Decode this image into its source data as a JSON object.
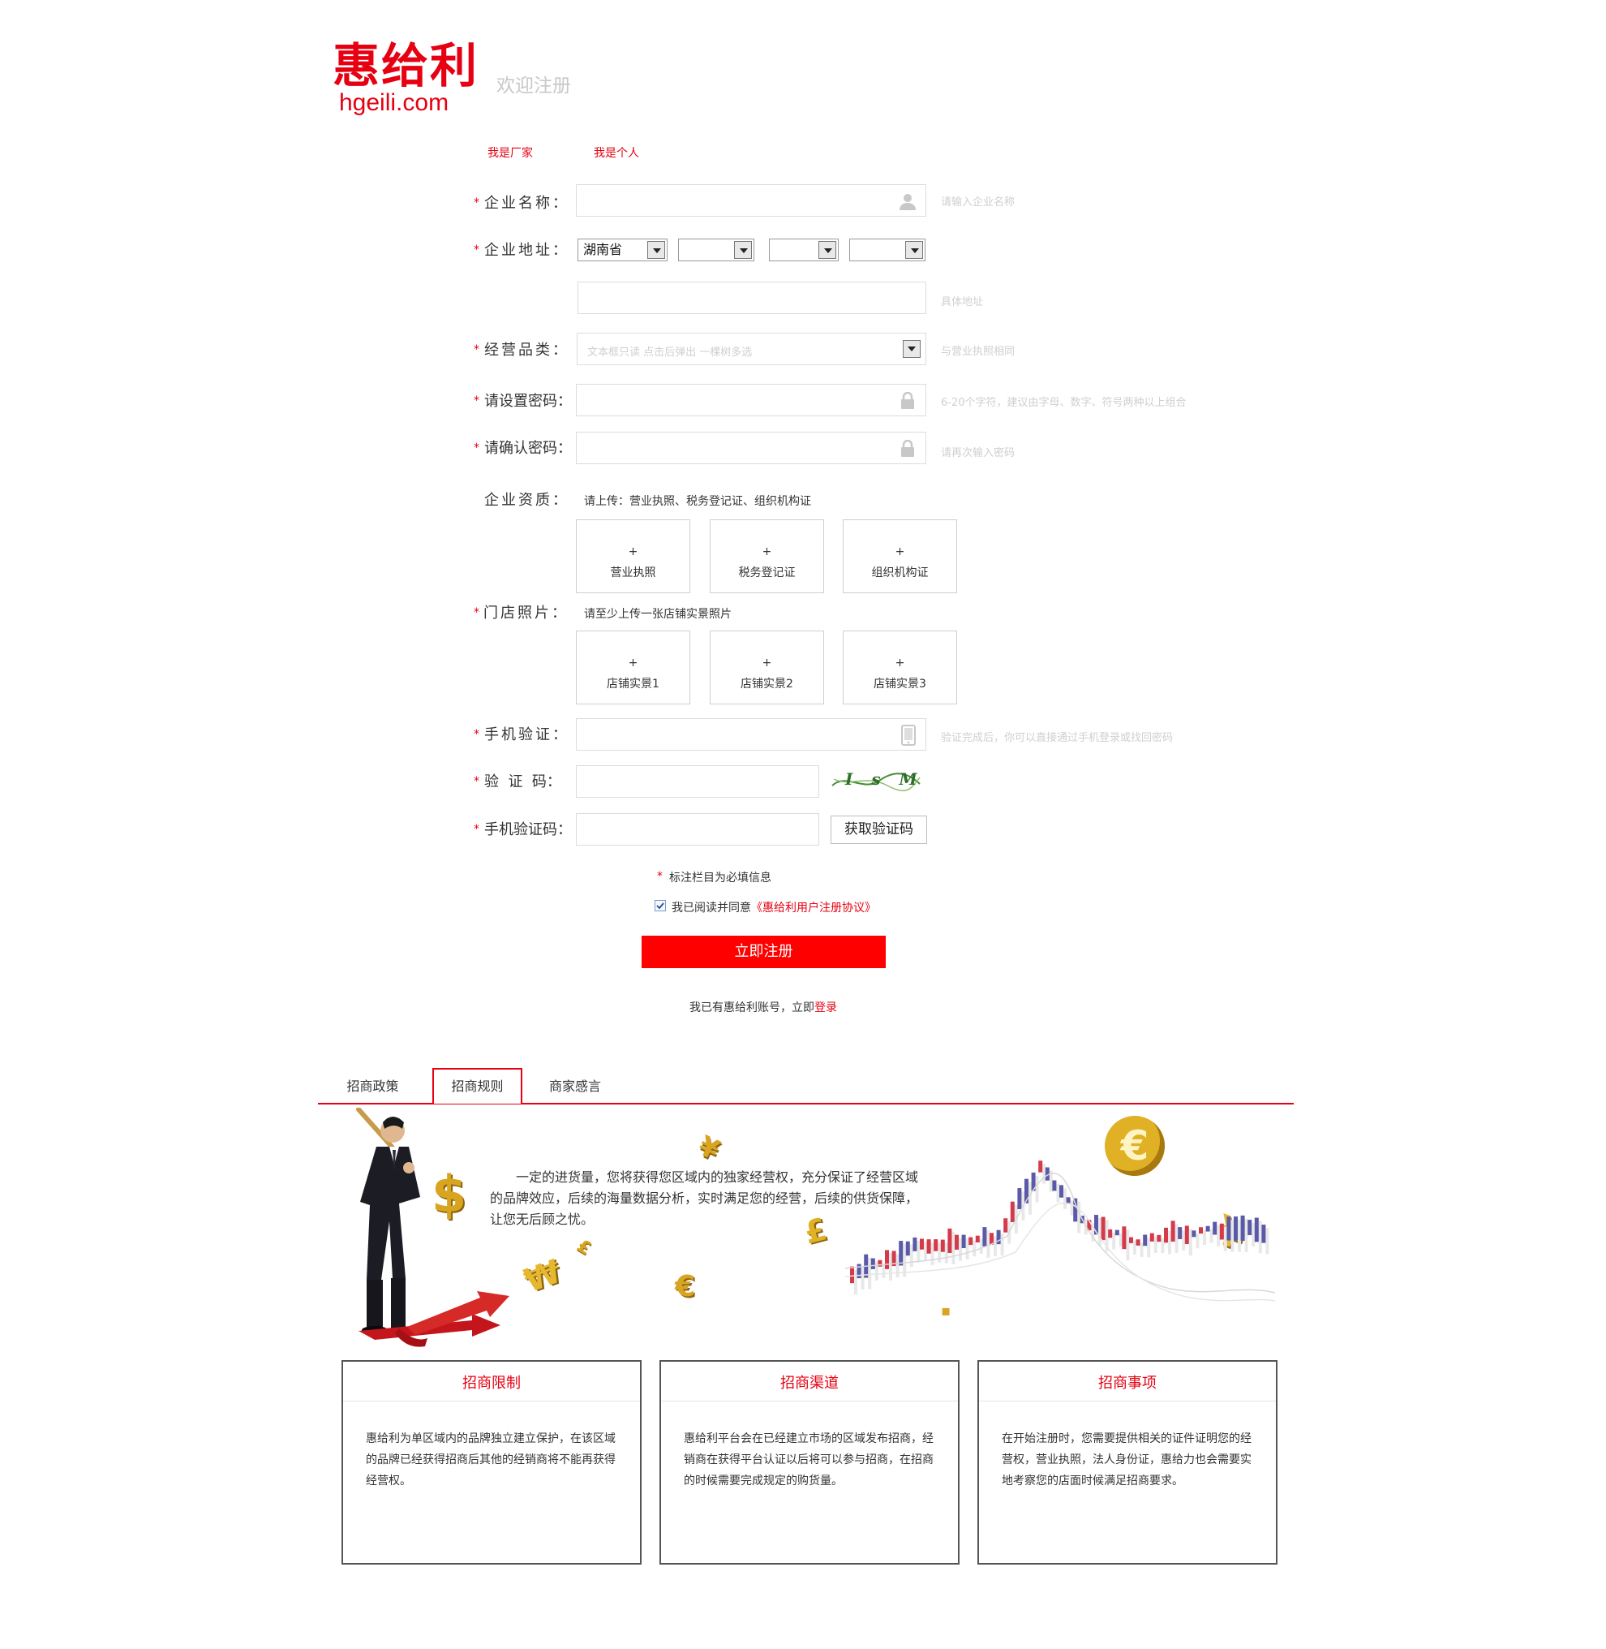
{
  "brand": {
    "name_cn": "惠给利",
    "domain": "hgeili.com",
    "welcome": "欢迎注册"
  },
  "account_types": [
    "我是厂家",
    "我是个人"
  ],
  "form": {
    "company_name": {
      "label": "企业名称：",
      "hint": "请输入企业名称"
    },
    "company_address": {
      "label": "企业地址：",
      "province": "湖南省",
      "detail_hint": "具体地址"
    },
    "category": {
      "label": "经营品类：",
      "placeholder": "文本框只读 点击后弹出 一棵树多选",
      "hint": "与营业执照相同"
    },
    "password": {
      "label": "请设置密码：",
      "hint": "6-20个字符，建议由字母、数字、符号两种以上组合"
    },
    "confirm_password": {
      "label": "请确认密码：",
      "hint": "请再次输入密码"
    },
    "qualification": {
      "label": "企业资质：",
      "note": "请上传：营业执照、税务登记证、组织机构证",
      "items": [
        "营业执照",
        "税务登记证",
        "组织机构证"
      ]
    },
    "store_photos": {
      "label": "门店照片：",
      "note": "请至少上传一张店铺实景照片",
      "items": [
        "店铺实景1",
        "店铺实景2",
        "店铺实景3"
      ]
    },
    "phone": {
      "label": "手机验证：",
      "hint": "验证完成后，你可以直接通过手机登录或找回密码"
    },
    "captcha": {
      "label": "验  证  码：",
      "image_text": "I s M"
    },
    "sms_code": {
      "label": "手机验证码：",
      "button": "获取验证码"
    },
    "required_star": "*",
    "required_note": "标注栏目为必填信息",
    "agree_prefix": "我已阅读并同意",
    "agree_link": "《惠给利用户注册协议》",
    "submit": "立即注册",
    "login_prefix": "我已有惠给利账号，立即",
    "login_link": "登录"
  },
  "tabs": [
    "招商政策",
    "招商规则",
    "商家感言"
  ],
  "active_tab": "招商规则",
  "banner_text": "一定的进货量，您将获得您区域内的独家经营权，充分保证了经营区域的品牌效应，后续的海量数据分析，实时满足您的经营，后续的供货保障，让您无后顾之忧。",
  "cards": [
    {
      "title": "招商限制",
      "body": "惠给利为单区域内的品牌独立建立保护，在该区域的品牌已经获得招商后其他的经销商将不能再获得经营权。"
    },
    {
      "title": "招商渠道",
      "body": "惠给利平台会在已经建立市场的区域发布招商，经销商在获得平台认证以后将可以参与招商，在招商的时候需要完成规定的购货量。"
    },
    {
      "title": "招商事项",
      "body": "在开始注册时，您需要提供相关的证件证明您的经营权，营业执照，法人身份证，惠给力也会需要实地考察您的店面时候满足招商要求。"
    }
  ],
  "colors": {
    "brand_red": "#e60012",
    "button_red": "#ff0000",
    "hint_gray": "#cfcfcf",
    "gold": "#d9a521"
  },
  "icons": [
    "user-icon",
    "lock-icon",
    "phone-icon",
    "dropdown-arrow-icon",
    "checkbox-checked-icon",
    "dollar-icon",
    "euro-icon",
    "yen-icon",
    "won-icon",
    "pound-icon"
  ]
}
